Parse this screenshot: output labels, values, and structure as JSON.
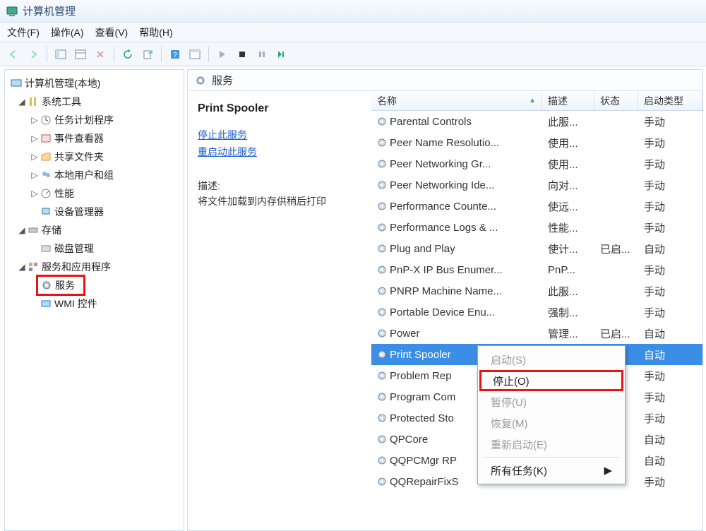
{
  "window": {
    "title": "计算机管理"
  },
  "menu": {
    "file": "文件(F)",
    "action": "操作(A)",
    "view": "查看(V)",
    "help": "帮助(H)"
  },
  "header": {
    "label": "服务"
  },
  "detail": {
    "title": "Print Spooler",
    "stop_link": "停止此服务",
    "restart_link": "重启动此服务",
    "desc_label": "描述:",
    "desc_text": "将文件加载到内存供稍后打印"
  },
  "columns": {
    "name": "名称",
    "desc": "描述",
    "state": "状态",
    "start": "启动类型"
  },
  "tree": {
    "root": "计算机管理(本地)",
    "system_tools": "系统工具",
    "task_scheduler": "任务计划程序",
    "event_viewer": "事件查看器",
    "shared_folders": "共享文件夹",
    "local_users": "本地用户和组",
    "performance": "性能",
    "device_manager": "设备管理器",
    "storage": "存储",
    "disk_mgmt": "磁盘管理",
    "services_apps": "服务和应用程序",
    "services": "服务",
    "wmi": "WMI 控件"
  },
  "services": [
    {
      "name": "Parental Controls",
      "desc": "此服...",
      "state": "",
      "start": "手动"
    },
    {
      "name": "Peer Name Resolutio...",
      "desc": "使用...",
      "state": "",
      "start": "手动"
    },
    {
      "name": "Peer Networking Gr...",
      "desc": "使用...",
      "state": "",
      "start": "手动"
    },
    {
      "name": "Peer Networking Ide...",
      "desc": "向对...",
      "state": "",
      "start": "手动"
    },
    {
      "name": "Performance Counte...",
      "desc": "使远...",
      "state": "",
      "start": "手动"
    },
    {
      "name": "Performance Logs & ...",
      "desc": "性能...",
      "state": "",
      "start": "手动"
    },
    {
      "name": "Plug and Play",
      "desc": "使计...",
      "state": "已启...",
      "start": "自动"
    },
    {
      "name": "PnP-X IP Bus Enumer...",
      "desc": "PnP...",
      "state": "",
      "start": "手动"
    },
    {
      "name": "PNRP Machine Name...",
      "desc": "此服...",
      "state": "",
      "start": "手动"
    },
    {
      "name": "Portable Device Enu...",
      "desc": "强制...",
      "state": "",
      "start": "手动"
    },
    {
      "name": "Power",
      "desc": "管理...",
      "state": "已启...",
      "start": "自动"
    },
    {
      "name": "Print Spooler",
      "desc": "",
      "state": "",
      "start": "自动",
      "selected": true
    },
    {
      "name": "Problem Rep",
      "desc": "",
      "state": "",
      "start": "手动"
    },
    {
      "name": "Program Com",
      "desc": "",
      "state": "",
      "start": "手动"
    },
    {
      "name": "Protected Sto",
      "desc": "",
      "state": "",
      "start": "手动"
    },
    {
      "name": "QPCore",
      "desc": "",
      "state": "",
      "start": "自动"
    },
    {
      "name": "QQPCMgr RP",
      "desc": "",
      "state": "",
      "start": "自动"
    },
    {
      "name": "QQRepairFixS",
      "desc": "",
      "state": "",
      "start": "手动"
    }
  ],
  "context_menu": {
    "start": "启动(S)",
    "stop": "停止(O)",
    "pause": "暂停(U)",
    "resume": "恢复(M)",
    "restart": "重新启动(E)",
    "all_tasks": "所有任务(K)"
  }
}
